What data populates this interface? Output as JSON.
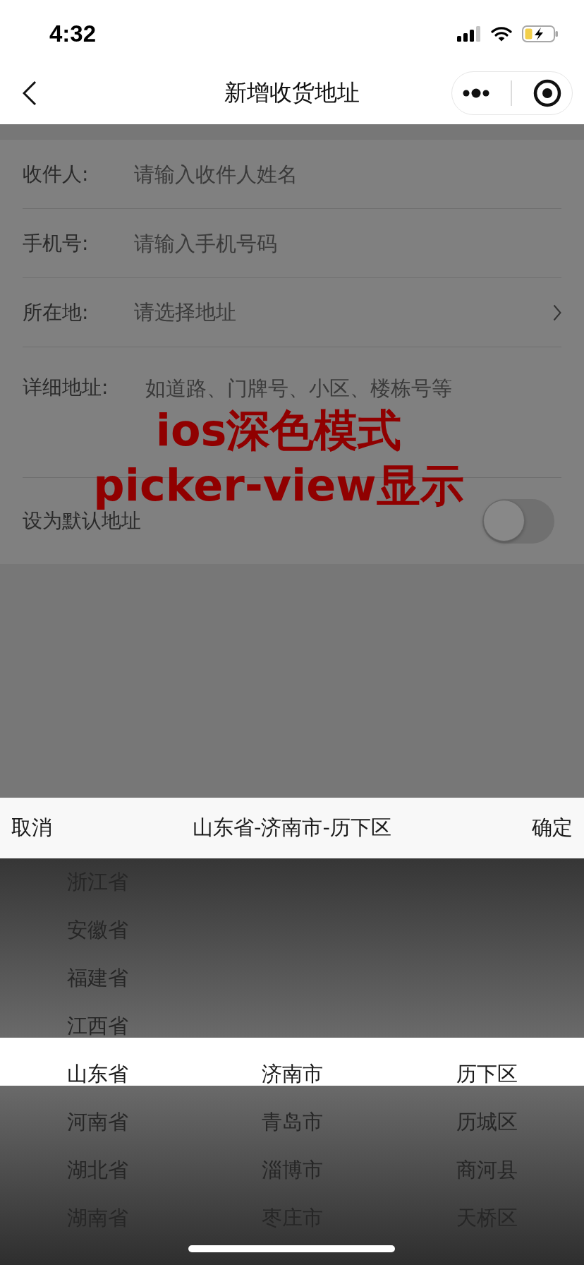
{
  "status_bar": {
    "time": "4:32"
  },
  "nav_bar": {
    "title": "新增收货地址"
  },
  "form": {
    "fields": [
      {
        "kind": "input",
        "label": "收件人:",
        "placeholder": "请输入收件人姓名"
      },
      {
        "kind": "input",
        "label": "手机号:",
        "placeholder": "请输入手机号码"
      },
      {
        "kind": "select",
        "label": "所在地:",
        "placeholder": "请选择地址"
      },
      {
        "kind": "textarea",
        "label": "详细地址:",
        "placeholder": "如道路、门牌号、小区、楼栋号等"
      },
      {
        "kind": "switch",
        "label": "设为默认地址",
        "checked": false
      }
    ]
  },
  "annotation": {
    "lines": [
      "ios深色模式",
      "picker-view显示"
    ]
  },
  "picker": {
    "cancel": "取消",
    "title": "山东省-济南市-历下区",
    "confirm": "确定",
    "columns": [
      {
        "items": [
          {
            "label": "浙江省",
            "selected": false
          },
          {
            "label": "安徽省",
            "selected": false
          },
          {
            "label": "福建省",
            "selected": false
          },
          {
            "label": "江西省",
            "selected": false
          },
          {
            "label": "山东省",
            "selected": true
          },
          {
            "label": "河南省",
            "selected": false
          },
          {
            "label": "湖北省",
            "selected": false
          },
          {
            "label": "湖南省",
            "selected": false
          }
        ]
      },
      {
        "items": [
          {
            "label": "济南市",
            "selected": true
          },
          {
            "label": "青岛市",
            "selected": false
          },
          {
            "label": "淄博市",
            "selected": false
          },
          {
            "label": "枣庄市",
            "selected": false
          }
        ]
      },
      {
        "items": [
          {
            "label": "历下区",
            "selected": true
          },
          {
            "label": "历城区",
            "selected": false
          },
          {
            "label": "商河县",
            "selected": false
          },
          {
            "label": "天桥区",
            "selected": false
          }
        ]
      }
    ]
  }
}
